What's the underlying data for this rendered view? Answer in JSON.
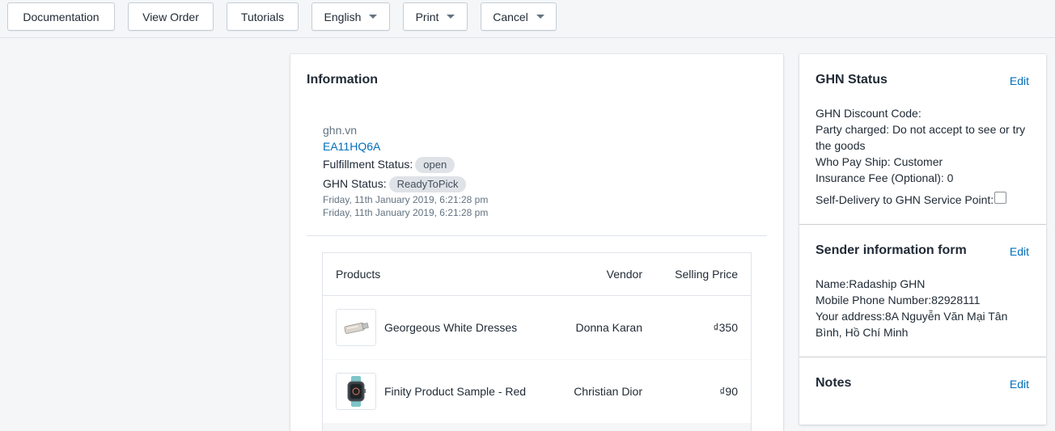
{
  "toolbar": {
    "documentation": "Documentation",
    "view_order": "View Order",
    "tutorials": "Tutorials",
    "language": "English",
    "print": "Print",
    "cancel": "Cancel"
  },
  "information": {
    "title": "Information",
    "source": "ghn.vn",
    "order_code": "EA11HQ6A",
    "fulfillment_label": "Fulfillment Status:",
    "fulfillment_value": "open",
    "ghn_status_label": "GHN Status:",
    "ghn_status_value": "ReadyToPick",
    "date_1": "Friday, 11th January 2019, 6:21:28 pm",
    "date_2": "Friday, 11th January 2019, 6:21:28 pm"
  },
  "products": {
    "headers": {
      "product": "Products",
      "vendor": "Vendor",
      "price": "Selling Price"
    },
    "rows": [
      {
        "name": "Georgeous White Dresses",
        "vendor": "Donna Karan",
        "price": "₫350",
        "thumb_icon": "usb-drive-icon"
      },
      {
        "name": "Finity Product Sample - Red",
        "vendor": "Christian Dior",
        "price": "₫90",
        "thumb_icon": "smartwatch-icon"
      }
    ]
  },
  "ghn_status": {
    "title": "GHN Status",
    "edit": "Edit",
    "discount_code": "GHN Discount Code:",
    "party_charged": "Party charged: Do not accept to see or try the goods",
    "who_pay_ship": "Who Pay Ship: Customer",
    "insurance_fee": "Insurance Fee (Optional): 0",
    "self_delivery": "Self-Delivery to GHN Service Point:"
  },
  "sender": {
    "title": "Sender information form",
    "edit": "Edit",
    "name": "Name:Radaship GHN",
    "phone": "Mobile Phone Number:82928111",
    "address": "Your address:8A Nguyễn Văn Mại Tân Bình, Hồ Chí Minh"
  },
  "notes": {
    "title": "Notes",
    "edit": "Edit"
  },
  "colors": {
    "link": "#006fbb",
    "badge_bg": "#dfe3e8",
    "page_bg": "#f4f6f8"
  }
}
